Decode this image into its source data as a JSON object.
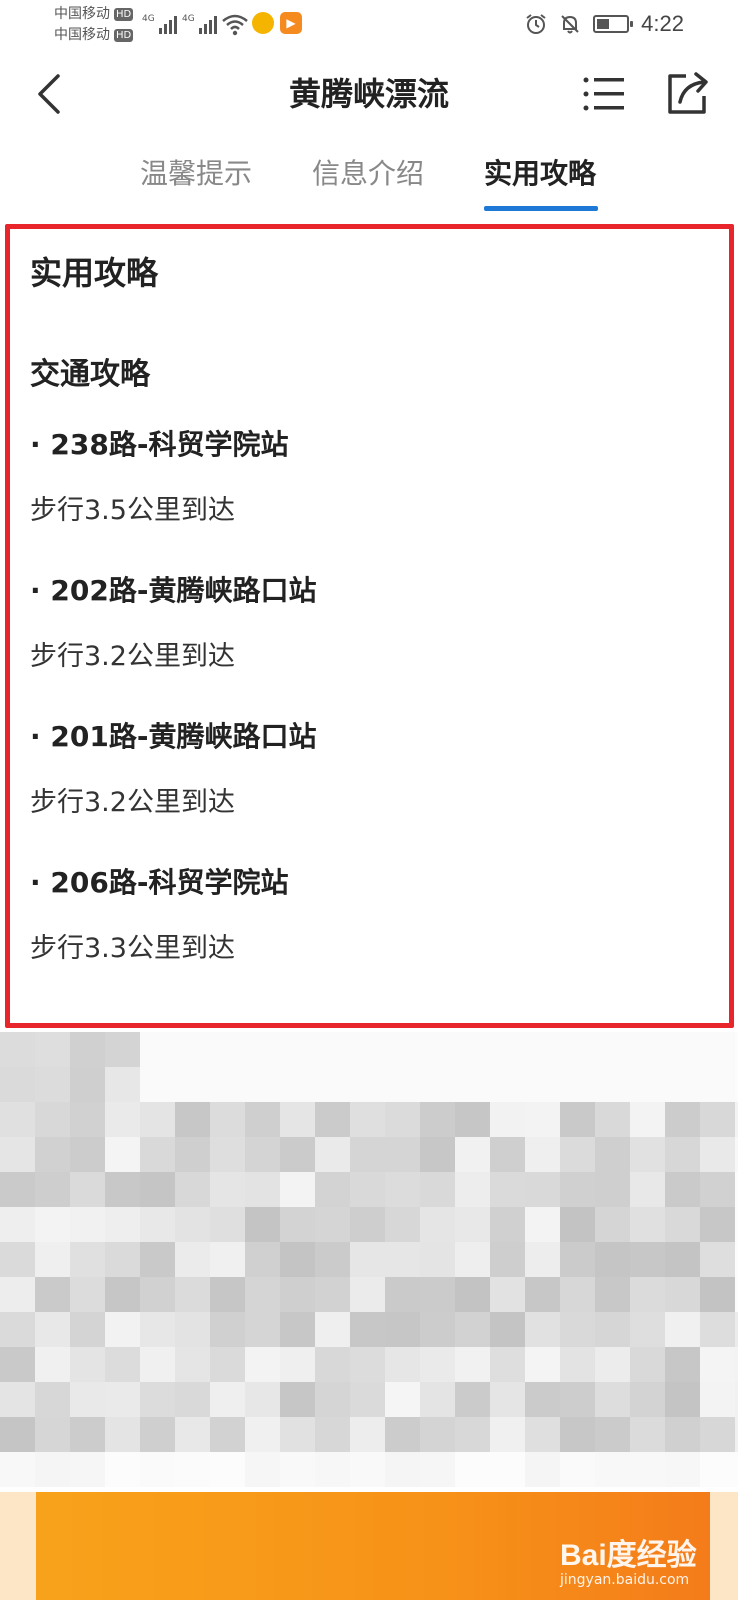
{
  "status_bar": {
    "carrier_1": "中国移动",
    "carrier_2": "中国移动",
    "hd_badge": "HD",
    "network_1": "4G",
    "network_2": "4G",
    "time": "4:22",
    "icons": [
      "signal-icon",
      "wifi-icon",
      "app-notification-icon",
      "video-app-icon",
      "alarm-icon",
      "mute-icon",
      "battery-icon"
    ]
  },
  "header": {
    "title": "黄腾峡漂流",
    "back_icon": "chevron-left-icon",
    "menu_icon": "list-menu-icon",
    "share_icon": "share-icon"
  },
  "tabs": [
    {
      "label": "温馨提示",
      "active": false
    },
    {
      "label": "信息介绍",
      "active": false
    },
    {
      "label": "实用攻略",
      "active": true
    }
  ],
  "content": {
    "section_title": "实用攻略",
    "subsection_title": "交通攻略",
    "routes": [
      {
        "name": "· 238路-科贸学院站",
        "desc": "步行3.5公里到达"
      },
      {
        "name": "· 202路-黄腾峡路口站",
        "desc": "步行3.2公里到达"
      },
      {
        "name": "· 201路-黄腾峡路口站",
        "desc": "步行3.2公里到达"
      },
      {
        "name": "· 206路-科贸学院站",
        "desc": "步行3.3公里到达"
      }
    ]
  },
  "watermark": {
    "logo": "Bai度经验",
    "url": "jingyan.baidu.com"
  },
  "colors": {
    "accent_tab": "#1e78d6",
    "highlight_border": "#e8252b",
    "bottom_bar": "#f8a21b"
  }
}
